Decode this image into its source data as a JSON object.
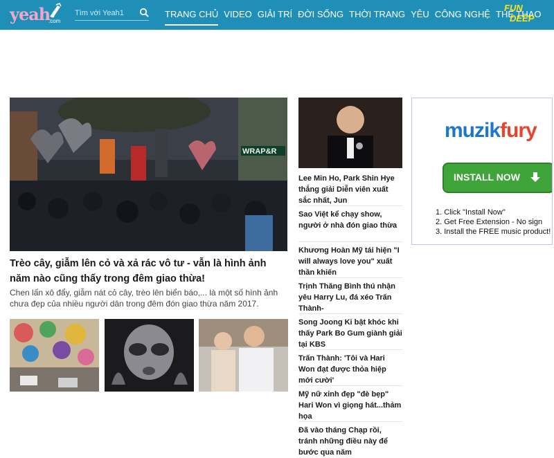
{
  "header": {
    "logo_text": "yeah",
    "logo_sub": ".com",
    "search": {
      "placeholder": "Tìm với Yeah1"
    },
    "nav": [
      {
        "label": "TRANG CHỦ",
        "active": true
      },
      {
        "label": "VIDEO"
      },
      {
        "label": "GIẢI TRÍ"
      },
      {
        "label": "ĐỜI SỐNG"
      },
      {
        "label": "THỜI TRANG"
      },
      {
        "label": "YÊU"
      },
      {
        "label": "CÔNG NGHỆ"
      },
      {
        "label": "THỂ THAO"
      }
    ],
    "fun_logo": {
      "line1": "FUN",
      "line2": "DEEP"
    }
  },
  "hero": {
    "title": "Trèo cây, giẫm lên cỏ và xả rác vô tư - vẫn là hình ảnh năm nào cũng thấy trong đêm giao thừa!",
    "description": "Chen lấn xô đẩy, giẫm nát cỏ cây, trèo lên biển báo,... là một số hình ảnh chưa đẹp của nhiều người dân trong đêm đón giao thừa năm 2017.",
    "sign_text": "WRAP&R"
  },
  "side_news": [
    "Lee Min Ho, Park Shin Hye thắng giải Diễn viên xuất sắc nhất, Jun",
    "Sao Việt kể chạy show, người ở nhà đón giao thừa",
    "Khương Hoàn Mỹ tái hiện \"I will always love you\" xuất thần khiến",
    "Trịnh Thăng Bình thú nhận yêu Harry Lu, đá xéo Trấn Thành-",
    "Song Joong Ki bật khóc khi thấy Park Bo Gum giành giải tại KBS",
    "Trấn Thành: 'Tôi và Hari Won đạt được thỏa hiệp mới cười'",
    "Mỹ nữ xinh đẹp \"đè bẹp\" Hari Won vì giọng hát...thảm họa",
    "Đã vào tháng Chạp rồi, tránh những điều này để bước qua năm"
  ],
  "ad": {
    "logo_a": "muzik",
    "logo_b": "fury",
    "button_label": "INSTALL NOW",
    "steps": [
      "1. Click \"Install Now\"",
      "2. Get Free Extension - No sign",
      "3. Install the FREE music product!"
    ]
  },
  "colors": {
    "header_bg": "#1f8fb8",
    "nav_text": "#ffffff",
    "ad_button": "#3fa43a"
  }
}
